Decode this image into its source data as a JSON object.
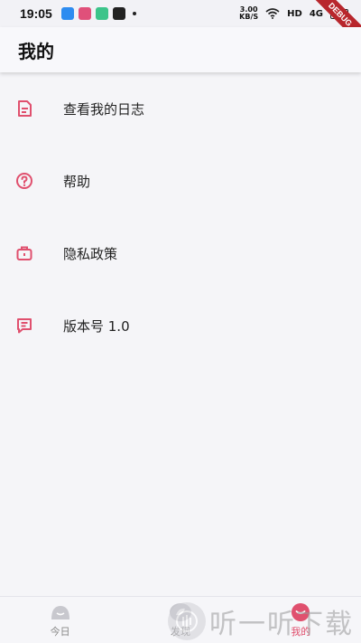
{
  "status_bar": {
    "time": "19:05",
    "speed_value": "3.00",
    "speed_unit": "KB/S",
    "network": "HD",
    "signal": "4G"
  },
  "debug_banner": "DEBUG",
  "app_bar": {
    "title": "我的"
  },
  "menu": {
    "items": [
      {
        "label": "查看我的日志",
        "icon": "log-document-icon"
      },
      {
        "label": "帮助",
        "icon": "help-circle-icon"
      },
      {
        "label": "隐私政策",
        "icon": "privacy-bag-icon"
      },
      {
        "label": "版本号 1.0",
        "icon": "version-note-icon"
      }
    ]
  },
  "bottom_nav": {
    "items": [
      {
        "label": "今日",
        "icon": "today-icon",
        "active": false
      },
      {
        "label": "发现",
        "icon": "discover-icon",
        "active": false
      },
      {
        "label": "我的",
        "icon": "profile-icon",
        "active": true
      }
    ]
  },
  "watermark": {
    "text": "听一听下载"
  },
  "colors": {
    "accent": "#e0506e",
    "background": "#f5f5f8",
    "inactive": "#888888"
  }
}
